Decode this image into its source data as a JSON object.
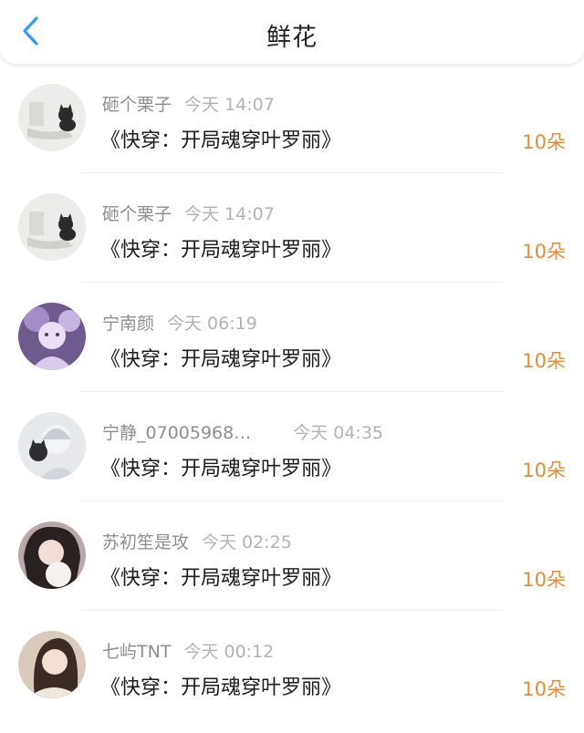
{
  "header": {
    "title": "鲜花",
    "back_icon": "chevron-left-icon"
  },
  "colors": {
    "accent": "#2e9bff",
    "flower_count": "#f08a2e",
    "username": "#8e8e8e",
    "time": "#b2b2b2"
  },
  "records": [
    {
      "username": "砸个栗子",
      "time": "今天 14:07",
      "book": "《快穿：开局魂穿叶罗丽》",
      "count": "10朵"
    },
    {
      "username": "砸个栗子",
      "time": "今天 14:07",
      "book": "《快穿：开局魂穿叶罗丽》",
      "count": "10朵"
    },
    {
      "username": "宁南颜",
      "time": "今天 06:19",
      "book": "《快穿：开局魂穿叶罗丽》",
      "count": "10朵"
    },
    {
      "username": "宁静_07005968…",
      "time": "今天 04:35",
      "book": "《快穿：开局魂穿叶罗丽》",
      "count": "10朵"
    },
    {
      "username": "苏初笙是攻",
      "time": "今天 02:25",
      "book": "《快穿：开局魂穿叶罗丽》",
      "count": "10朵"
    },
    {
      "username": "七屿TNT",
      "time": "今天 00:12",
      "book": "《快穿：开局魂穿叶罗丽》",
      "count": "10朵"
    }
  ]
}
